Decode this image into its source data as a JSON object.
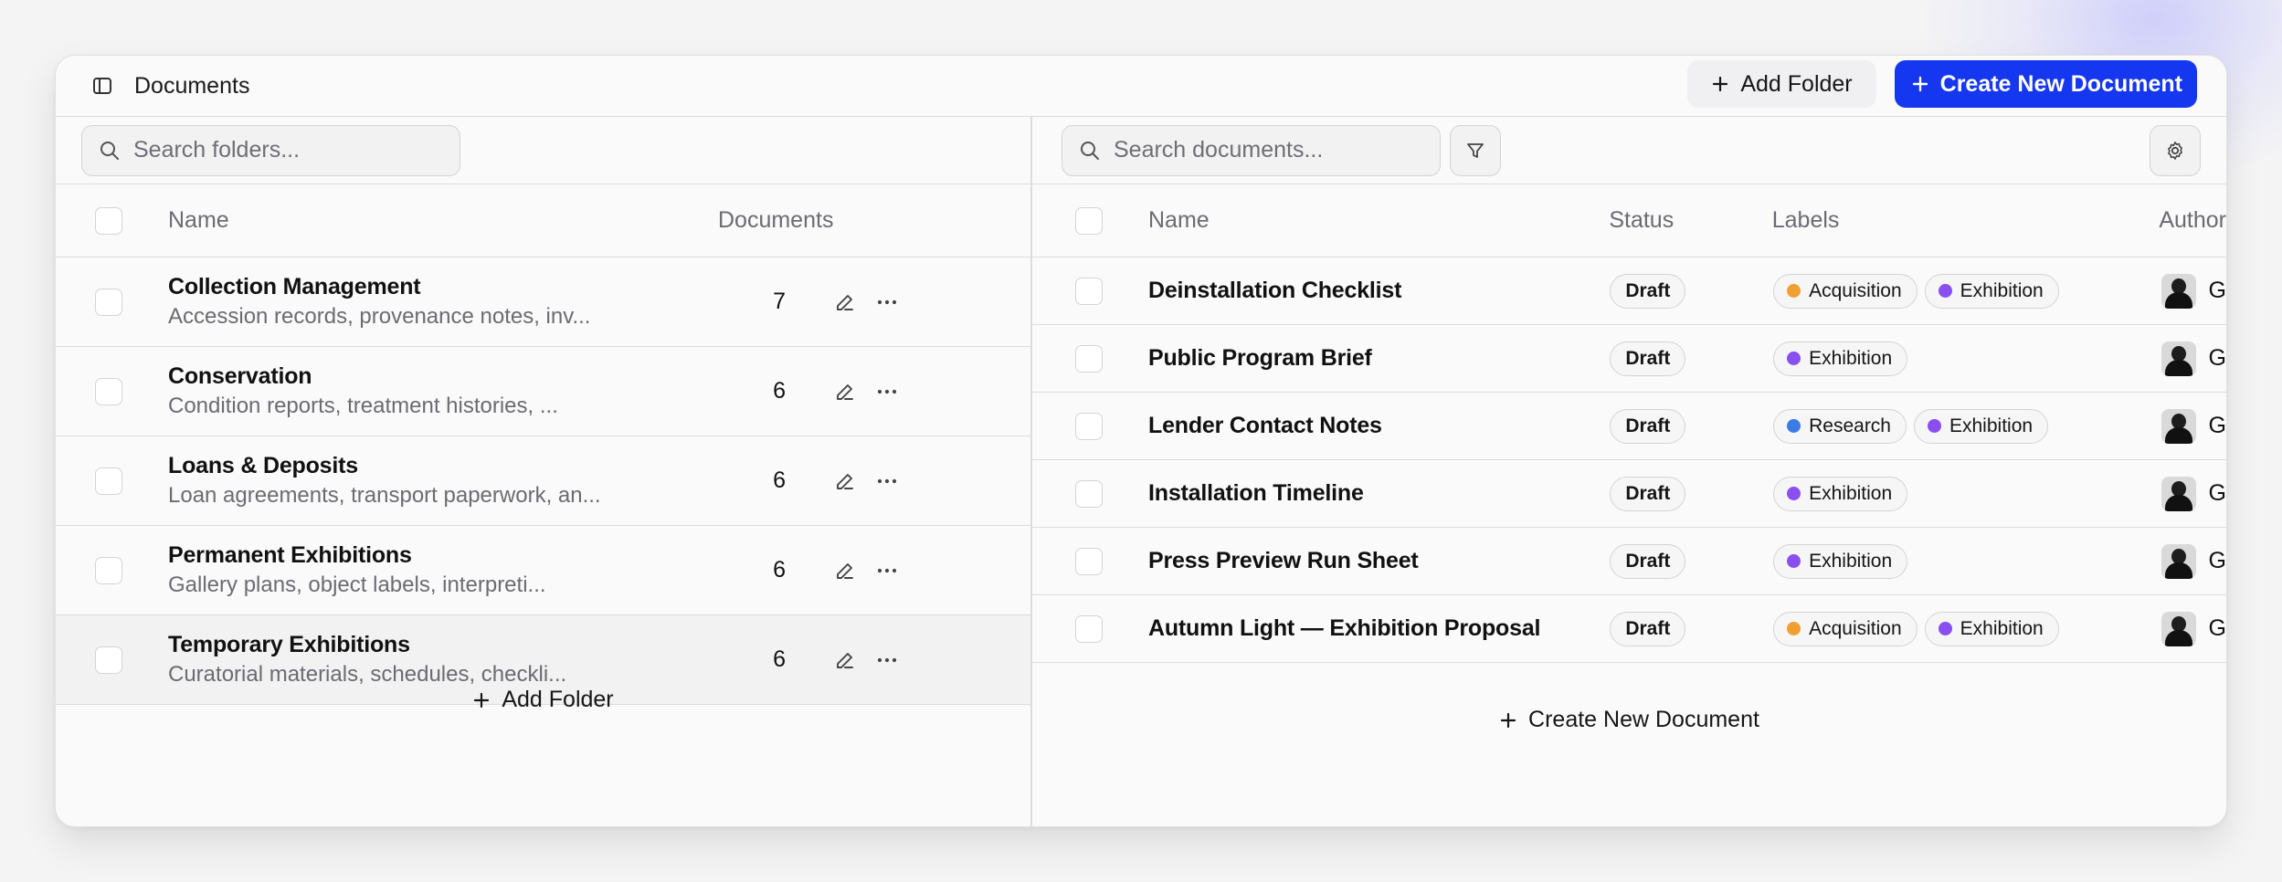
{
  "header": {
    "title": "Documents",
    "add_folder_label": "Add Folder",
    "create_doc_label": "Create New Document"
  },
  "folders": {
    "search_placeholder": "Search folders...",
    "columns": {
      "name": "Name",
      "documents": "Documents"
    },
    "items": [
      {
        "name": "Collection Management",
        "description": "Accession records, provenance notes, inv...",
        "count": "7"
      },
      {
        "name": "Conservation",
        "description": "Condition reports, treatment histories, ...",
        "count": "6"
      },
      {
        "name": "Loans & Deposits",
        "description": "Loan agreements, transport paperwork, an...",
        "count": "6"
      },
      {
        "name": "Permanent Exhibitions",
        "description": "Gallery plans, object labels, interpreti...",
        "count": "6"
      },
      {
        "name": "Temporary Exhibitions",
        "description": "Curatorial materials, schedules, checkli...",
        "count": "6"
      }
    ],
    "add_folder_label": "Add Folder"
  },
  "documents": {
    "search_placeholder": "Search documents...",
    "columns": {
      "name": "Name",
      "status": "Status",
      "labels": "Labels",
      "author": "Author"
    },
    "items": [
      {
        "name": "Deinstallation Checklist",
        "status": "Draft",
        "labels": [
          "Acquisition",
          "Exhibition"
        ],
        "author": "G"
      },
      {
        "name": "Public Program Brief",
        "status": "Draft",
        "labels": [
          "Exhibition"
        ],
        "author": "G"
      },
      {
        "name": "Lender Contact Notes",
        "status": "Draft",
        "labels": [
          "Research",
          "Exhibition"
        ],
        "author": "G"
      },
      {
        "name": "Installation Timeline",
        "status": "Draft",
        "labels": [
          "Exhibition"
        ],
        "author": "G"
      },
      {
        "name": "Press Preview Run Sheet",
        "status": "Draft",
        "labels": [
          "Exhibition"
        ],
        "author": "G"
      },
      {
        "name": "Autumn Light — Exhibition Proposal",
        "status": "Draft",
        "labels": [
          "Acquisition",
          "Exhibition"
        ],
        "author": "G"
      }
    ],
    "create_label": "Create New Document"
  },
  "label_colors": {
    "Acquisition": "#f0a030",
    "Exhibition": "#8a4ff0",
    "Research": "#3b7be8"
  },
  "colors": {
    "accent": "#1437ef"
  }
}
